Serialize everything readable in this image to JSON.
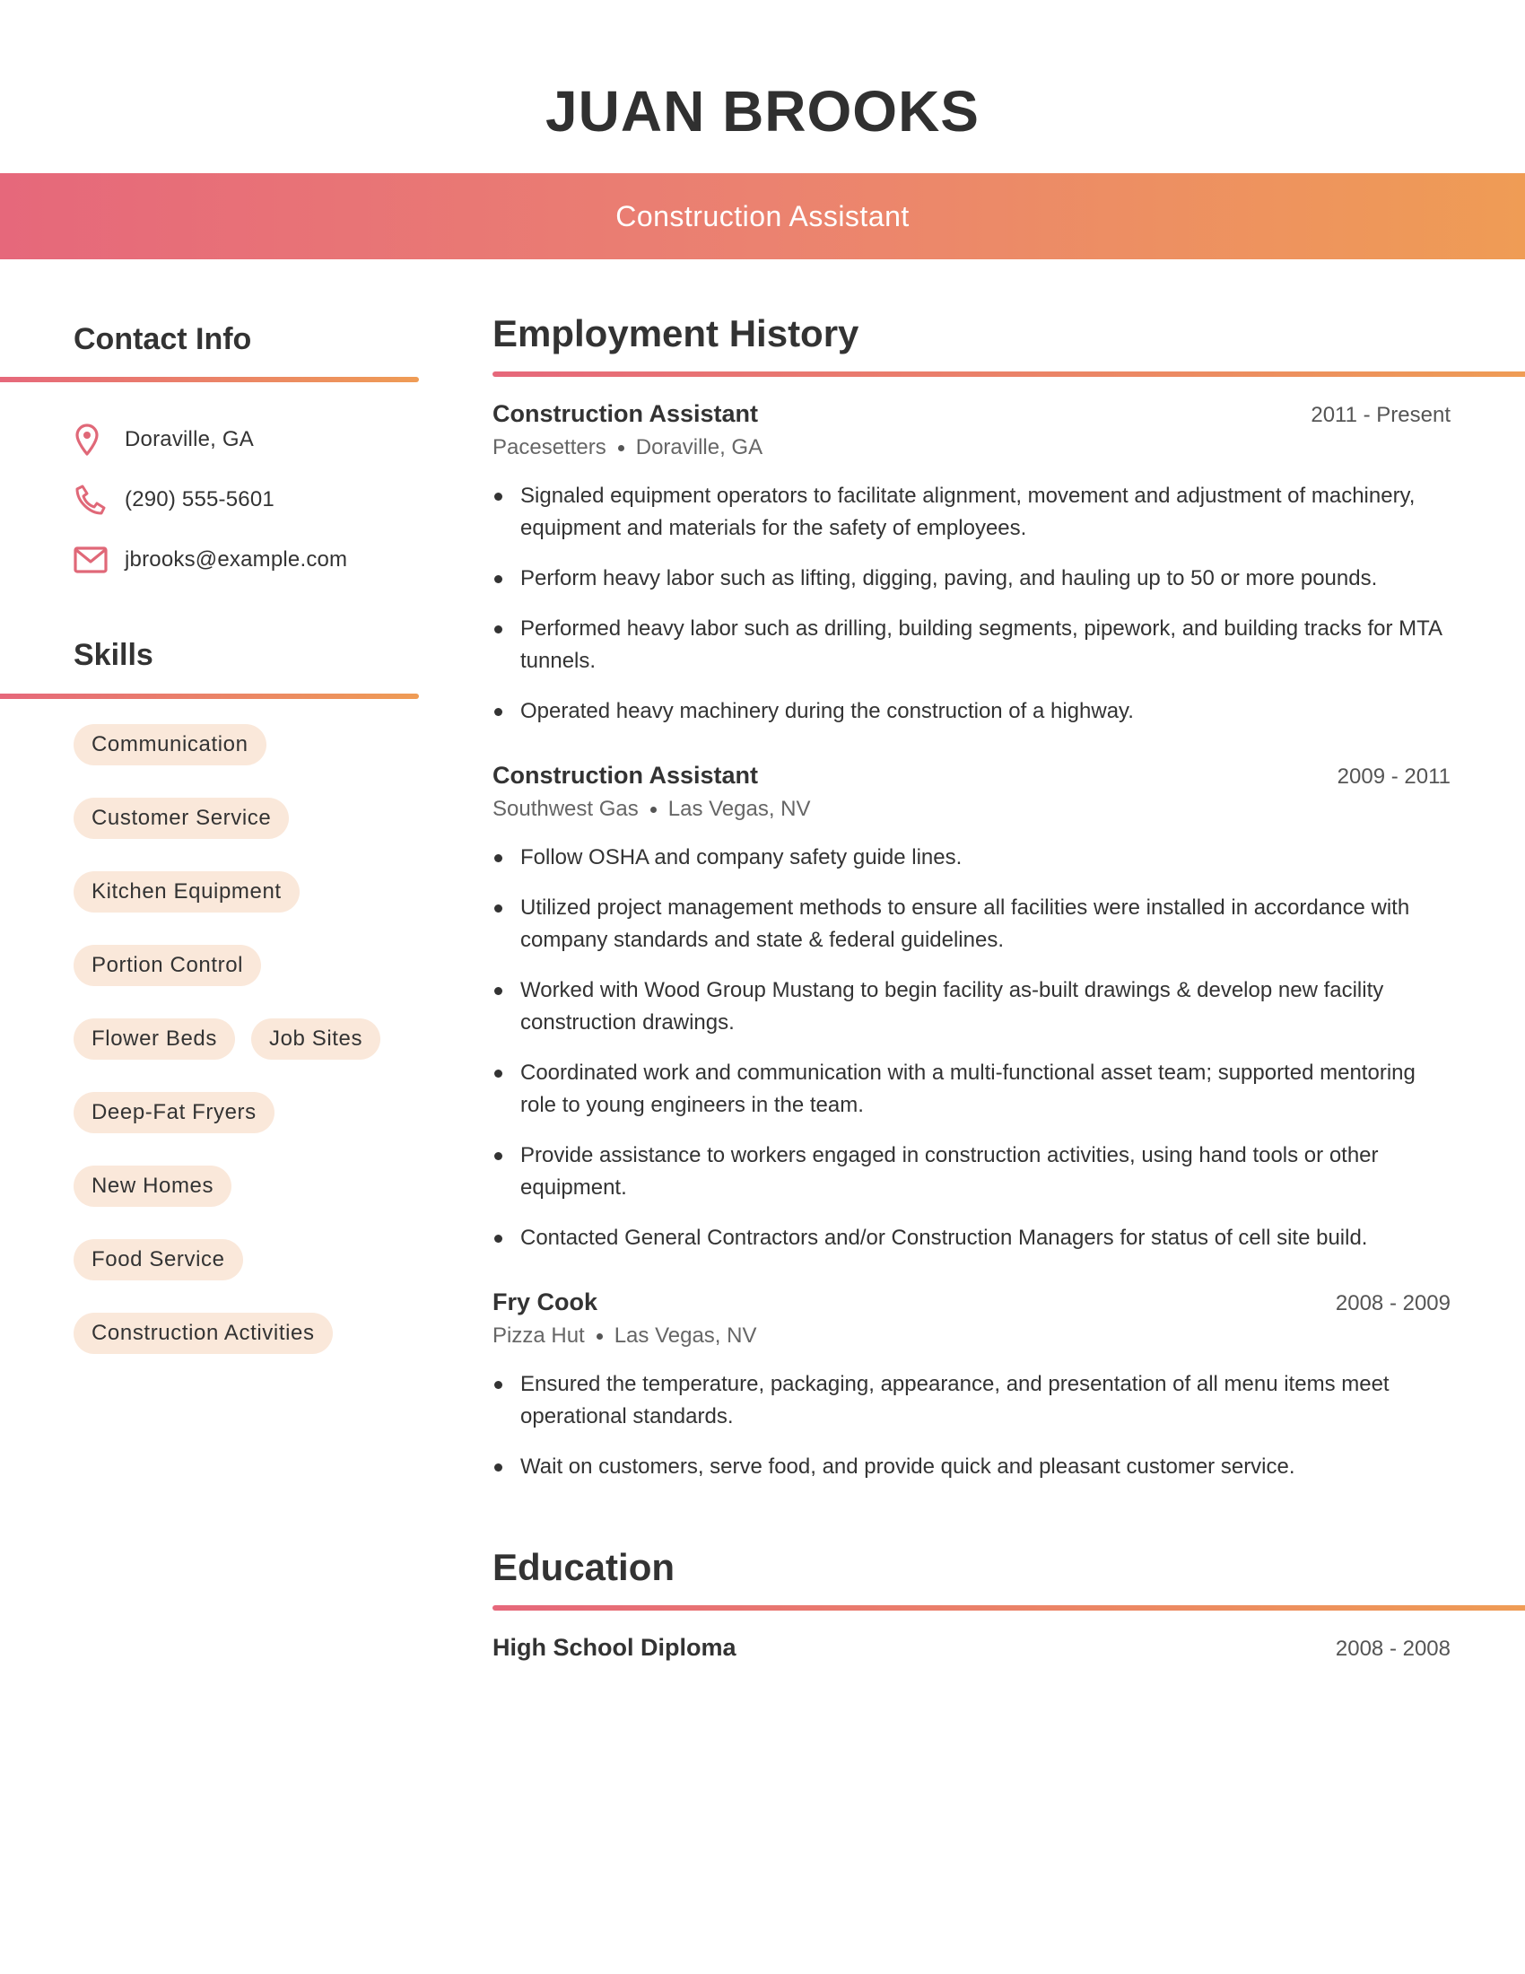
{
  "header": {
    "name": "JUAN BROOKS",
    "title": "Construction Assistant"
  },
  "colors": {
    "gradient_start": "#e6687b",
    "gradient_end": "#ef9c55",
    "pill_background": "#fae8da",
    "icon": "#e06878",
    "text": "#333333"
  },
  "contact": {
    "heading": "Contact Info",
    "items": [
      {
        "icon": "map-pin-icon",
        "text": "Doraville, GA"
      },
      {
        "icon": "phone-icon",
        "text": "(290) 555-5601"
      },
      {
        "icon": "mail-icon",
        "text": "jbrooks@example.com"
      }
    ]
  },
  "skills": {
    "heading": "Skills",
    "items": [
      "Communication",
      "Customer Service",
      "Kitchen Equipment",
      "Portion Control",
      "Flower Beds",
      "Job Sites",
      "Deep-Fat Fryers",
      "New Homes",
      "Food Service",
      "Construction Activities"
    ]
  },
  "employment": {
    "heading": "Employment History",
    "jobs": [
      {
        "title": "Construction Assistant",
        "dates": "2011 - Present",
        "company": "Pacesetters",
        "location": "Doraville, GA",
        "bullets": [
          "Signaled equipment operators to facilitate alignment, movement and adjustment of machinery, equipment and materials for the safety of employees.",
          "Perform heavy labor such as lifting, digging, paving, and hauling up to 50 or more pounds.",
          "Performed heavy labor such as drilling, building segments, pipework, and building tracks for MTA tunnels.",
          "Operated heavy machinery during the construction of a highway."
        ]
      },
      {
        "title": "Construction Assistant",
        "dates": "2009 - 2011",
        "company": "Southwest Gas",
        "location": "Las Vegas, NV",
        "bullets": [
          "Follow OSHA and company safety guide lines.",
          "Utilized project management methods to ensure all facilities were installed in accordance with company standards and state & federal guidelines.",
          "Worked with Wood Group Mustang to begin facility as-built drawings & develop new facility construction drawings.",
          "Coordinated work and communication with a multi-functional asset team; supported mentoring role to young engineers in the team.",
          "Provide assistance to workers engaged in construction activities, using hand tools or other equipment.",
          "Contacted General Contractors and/or Construction Managers for status of cell site build."
        ]
      },
      {
        "title": "Fry Cook",
        "dates": "2008 - 2009",
        "company": "Pizza Hut",
        "location": "Las Vegas, NV",
        "bullets": [
          "Ensured the temperature, packaging, appearance, and presentation of all menu items meet operational standards.",
          "Wait on customers, serve food, and provide quick and pleasant customer service."
        ]
      }
    ]
  },
  "education": {
    "heading": "Education",
    "items": [
      {
        "degree": "High School Diploma",
        "dates": "2008 - 2008"
      }
    ]
  }
}
